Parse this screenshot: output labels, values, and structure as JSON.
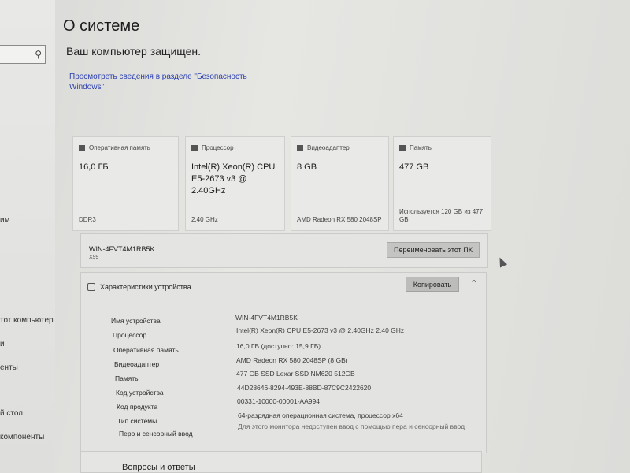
{
  "page": {
    "title": "О системе",
    "protected_text": "Ваш компьютер защищен.",
    "security_link": "Просмотреть сведения в разделе \"Безопасность Windows\""
  },
  "sidebar": {
    "search_icon": "search-icon",
    "items": [
      "им",
      "тот компьютер",
      "и",
      "енты",
      "й стол",
      "компоненты"
    ]
  },
  "cards": [
    {
      "title": "Оперативная память",
      "icon": "ram-icon",
      "value": "16,0 ГБ",
      "footer": "DDR3"
    },
    {
      "title": "Процессор",
      "icon": "cpu-icon",
      "value": "Intel(R) Xeon(R) CPU\nE5-2673 v3 @\n2.40GHz",
      "footer": "2.40 GHz"
    },
    {
      "title": "Видеоадаптер",
      "icon": "gpu-icon",
      "value": "8 GB",
      "footer": "AMD Radeon RX 580 2048SP"
    },
    {
      "title": "Память",
      "icon": "storage-icon",
      "value": "477 GB",
      "footer": "Используется 120 GB из 477 GB"
    }
  ],
  "device": {
    "name": "WIN-4FVT4M1RB5K",
    "model": "X99",
    "rename_label": "Переименовать этот ПК"
  },
  "specs": {
    "title": "Характеристики устройства",
    "copy_label": "Копировать",
    "rows": [
      {
        "label": "Имя устройства",
        "value": "WIN-4FVT4M1RB5K"
      },
      {
        "label": "Процессор",
        "value": "Intel(R) Xeon(R) CPU E5-2673 v3 @ 2.40GHz   2.40 GHz"
      },
      {
        "label": "Оперативная память",
        "value": "16,0 ГБ (доступно: 15,9 ГБ)"
      },
      {
        "label": "Видеоадаптер",
        "value": "AMD Radeon RX 580 2048SP (8 GB)"
      },
      {
        "label": "Память",
        "value": "477 GB SSD Lexar SSD NM620 512GB"
      },
      {
        "label": "Код устройства",
        "value": "44D28646-8294-493E-88BD-87C9C2422620"
      },
      {
        "label": "Код продукта",
        "value": "00331-10000-00001-AA994"
      },
      {
        "label": "Тип системы",
        "value": "64-разрядная операционная система, процессор x64"
      },
      {
        "label": "Перо и сенсорный ввод",
        "value": "Для этого монитора недоступен ввод с помощью пера и сенсорный ввод"
      }
    ]
  },
  "faq": {
    "title": "Вопросы и ответы"
  }
}
